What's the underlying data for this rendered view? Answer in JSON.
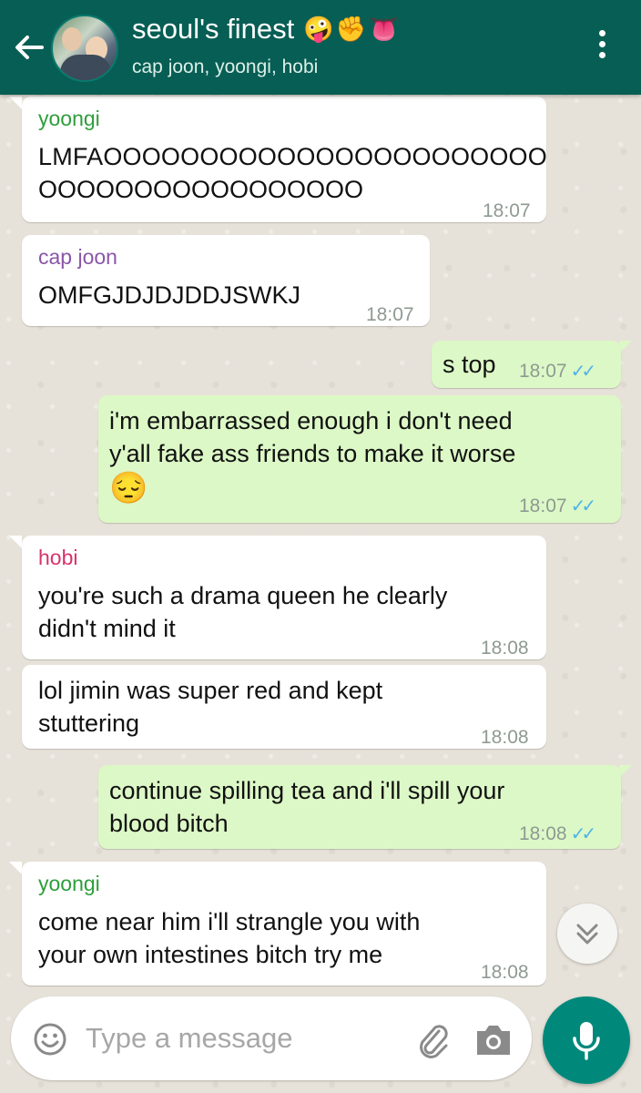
{
  "header": {
    "title": "seoul's finest",
    "title_emojis": "🤪✊👅",
    "subtitle": "cap joon, yoongi, hobi"
  },
  "messages": [
    {
      "sender": "yoongi",
      "text1": "LMFAOOOOOOOOOOOOOOOOOOOOOOO",
      "text2": "OOOOOOOOOOOOOOOOO",
      "time": "18:07"
    },
    {
      "sender": "cap joon",
      "text": "OMFGJDJDJDDJSWKJ",
      "time": "18:07"
    },
    {
      "text": "s top",
      "time": "18:07",
      "ticks": "✓✓"
    },
    {
      "text1": "i'm embarrassed enough i don't need",
      "text2": "y'all fake ass friends to make it worse",
      "emoji": "😔",
      "time": "18:07",
      "ticks": "✓✓"
    },
    {
      "sender": "hobi",
      "text1": "you're such a drama queen he clearly",
      "text2": "didn't mind it",
      "time": "18:08"
    },
    {
      "text1": "lol jimin was super red and kept",
      "text2": "stuttering",
      "time": "18:08"
    },
    {
      "text1": "continue spilling tea and i'll spill your",
      "text2": "blood bitch",
      "time": "18:08",
      "ticks": "✓✓"
    },
    {
      "sender": "yoongi",
      "text1": "come near him i'll strangle you with",
      "text2": "your own intestines bitch try me",
      "time": "18:08"
    }
  ],
  "colors": {
    "header": "#075e54",
    "outgoing_bubble": "#dcf8c6",
    "sender_yoongi": "#2e9e3a",
    "sender_cap_joon": "#8a56a8",
    "sender_hobi": "#d6336c",
    "read_ticks": "#4fb3e8",
    "mic_button": "#00897b"
  },
  "input": {
    "placeholder": "Type a message"
  },
  "icons": {
    "back": "arrow-left-icon",
    "menu": "more-vertical-icon",
    "scroll": "chevron-double-down-icon",
    "emoji": "smiley-icon",
    "attach": "paperclip-icon",
    "camera": "camera-icon",
    "mic": "microphone-icon"
  }
}
